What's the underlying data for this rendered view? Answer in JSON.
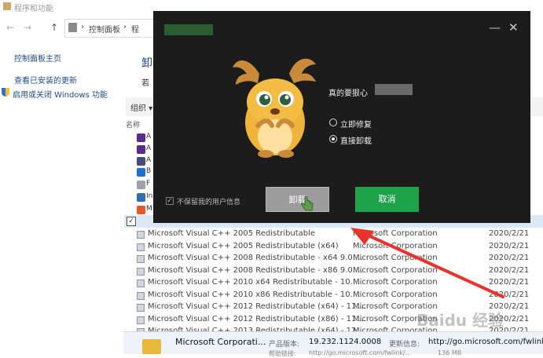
{
  "window": {
    "title": "程序和功能"
  },
  "address": {
    "back": "←",
    "forward": "→",
    "up": "↑",
    "crumb1": "控制面板",
    "sep": "›",
    "crumb2": "程"
  },
  "left_nav": {
    "home": "控制面板主页",
    "updates": "查看已安装的更新",
    "features": "启用或关闭 Windows 功能"
  },
  "main": {
    "header_partial": "卸",
    "desc_partial": "若",
    "organize": "组织 ▾",
    "col_name": "名称"
  },
  "app_list_partial": [
    {
      "label": "A",
      "color": "#5b2a8e"
    },
    {
      "label": "A",
      "color": "#5b2a8e"
    },
    {
      "label": "A",
      "color": "#4a4a7a"
    },
    {
      "label": "B",
      "color": "#1f6fd1"
    },
    {
      "label": "F",
      "color": "#9aa3ad"
    },
    {
      "label": "In",
      "color": "#2f6fb0"
    },
    {
      "label": "M",
      "color": "#e8562a"
    },
    {
      "label": "M",
      "color": "#2a7ad1"
    }
  ],
  "programs": [
    {
      "name": "Microsoft Visual C++ 2005 Redistributable",
      "publisher": "Microsoft Corporation",
      "date": "2020/2/21"
    },
    {
      "name": "Microsoft Visual C++ 2005 Redistributable (x64)",
      "publisher": "Microsoft Corporation",
      "date": "2020/2/21"
    },
    {
      "name": "Microsoft Visual C++ 2008 Redistributable - x64 9.0....",
      "publisher": "Microsoft Corporation",
      "date": "2020/2/21"
    },
    {
      "name": "Microsoft Visual C++ 2008 Redistributable - x86 9.0....",
      "publisher": "Microsoft Corporation",
      "date": "2020/2/21"
    },
    {
      "name": "Microsoft Visual C++ 2010  x64 Redistributable - 10....",
      "publisher": "Microsoft Corporation",
      "date": "2020/2/21"
    },
    {
      "name": "Microsoft Visual C++ 2010  x86 Redistributable - 10....",
      "publisher": "Microsoft Corporation",
      "date": "2020/2/21"
    },
    {
      "name": "Microsoft Visual C++ 2012 Redistributable (x64) - 11....",
      "publisher": "Microsoft Corporation",
      "date": "2020/2/21"
    },
    {
      "name": "Microsoft Visual C++ 2012 Redistributable (x86) - 11....",
      "publisher": "Microsoft Corporation",
      "date": "2020/2/21"
    },
    {
      "name": "Microsoft Visual C++ 2013 Redistributable (x64) - 12....",
      "publisher": "Microsoft Corporation",
      "date": "2020/2/21"
    }
  ],
  "details": {
    "publisher": "Microsoft Corporati...",
    "version_label": "产品版本:",
    "version": "19.232.1124.0008",
    "update_label": "更新信息:",
    "update_url": "http://go.microsoft.com/fwlink/",
    "help_label": "帮助链接:",
    "help_url": "http://go.microsoft.com/fwlink/...",
    "size": "136 MB"
  },
  "watermark": "Baidu 经验",
  "dialog": {
    "minimize": "—",
    "close": "✕",
    "question": "真的要狠心",
    "option_repair": "立即修复",
    "option_uninstall": "直接卸载",
    "keep_info": "不保留我的用户信息",
    "keep_check": "✓",
    "uninstall_button": "卸载",
    "cancel_button": "取消",
    "accent": "#1fa34a"
  },
  "annotation": {
    "arrow_color": "#e8322b"
  }
}
